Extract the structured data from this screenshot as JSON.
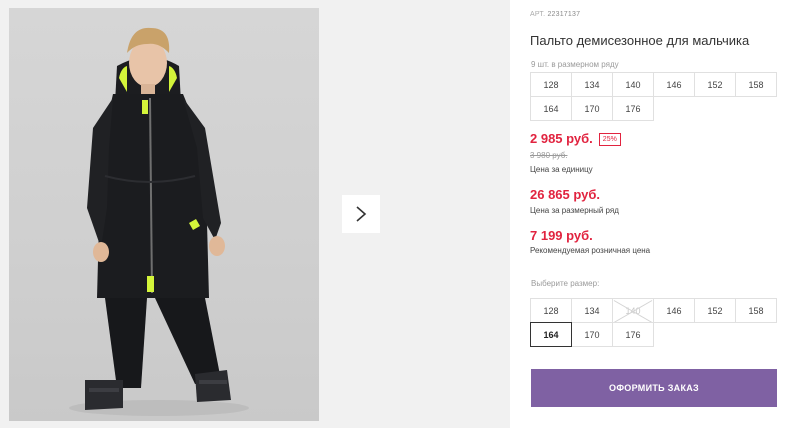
{
  "product": {
    "art_label": "АРТ.",
    "art_number": "22317137",
    "title": "Пальто демисезонное для мальчика",
    "row_count_text": "9 шт. в размерном ряду"
  },
  "size_row": [
    "128",
    "134",
    "140",
    "146",
    "152",
    "158",
    "164",
    "170",
    "176"
  ],
  "prices": {
    "unit_price": "2 985 руб.",
    "discount_badge": "25%",
    "old_price": "3 980 руб.",
    "unit_note": "Цена за единицу",
    "row_price": "26 865 руб.",
    "row_note": "Цена за размерный ряд",
    "retail_price": "7 199 руб.",
    "retail_note": "Рекомендуемая розничная цена"
  },
  "size_selector": {
    "label": "Выберите размер:",
    "sizes": [
      "128",
      "134",
      "140",
      "146",
      "152",
      "158",
      "164",
      "170",
      "176"
    ],
    "selected": "164",
    "disabled": [
      "140"
    ]
  },
  "order_button": {
    "label": "ОФОРМИТЬ ЗАКАЗ"
  },
  "icons": {
    "next": "chevron-right-icon"
  },
  "colors": {
    "accent": "#7f61a3",
    "price_red": "#e1233f",
    "photo_bg": "#d3d3d3",
    "jacket": "#1b1c1f",
    "neon": "#d4f53a"
  }
}
